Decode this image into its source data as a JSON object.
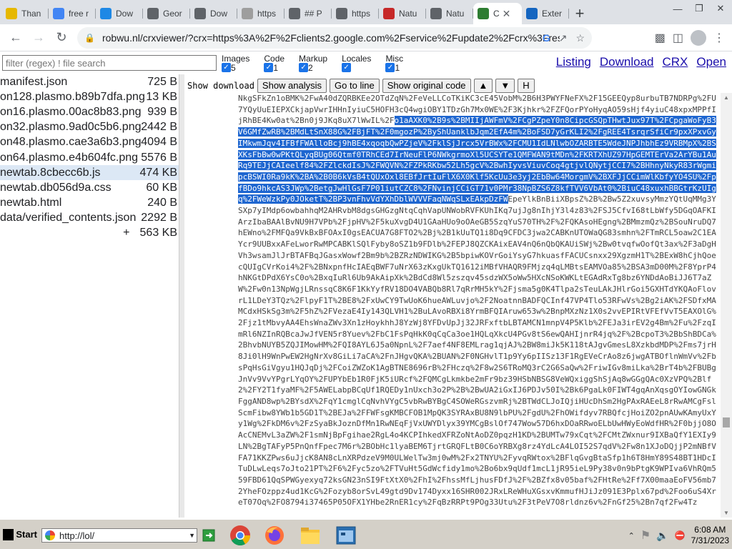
{
  "browser": {
    "tabs": [
      {
        "title": "Than",
        "icon": "tumblr-icon",
        "color": "#e6b800"
      },
      {
        "title": "free r",
        "icon": "google-icon",
        "color": "#4285f4"
      },
      {
        "title": "Dow",
        "icon": "vscode-icon",
        "color": "#1e88e5"
      },
      {
        "title": "Geor",
        "icon": "page-icon",
        "color": "#5f6368"
      },
      {
        "title": "Dow",
        "icon": "globe-icon",
        "color": "#5f6368"
      },
      {
        "title": "https",
        "icon": "image-icon",
        "color": "#9e9e9e"
      },
      {
        "title": "## P",
        "icon": "page-icon",
        "color": "#5f6368"
      },
      {
        "title": "https",
        "icon": "globe-icon",
        "color": "#5f6368"
      },
      {
        "title": "Natu",
        "icon": "page-icon",
        "color": "#c62828"
      },
      {
        "title": "Natu",
        "icon": "globe-icon",
        "color": "#5f6368"
      },
      {
        "title": "C",
        "icon": "crx-icon",
        "color": "#2e7d32",
        "active": true
      },
      {
        "title": "Exter",
        "icon": "puzzle-icon",
        "color": "#1565c0"
      }
    ],
    "url": "robwu.nl/crxviewer/?crx=https%3A%2F%2Fclients2.google.com%2Fservice%2Fupdate2%2Fcrx%3Fres..."
  },
  "viewer": {
    "filter_placeholder": "filter (regex) ! file search",
    "categories": [
      {
        "label": "Images",
        "count": "5"
      },
      {
        "label": "Code",
        "count": "1"
      },
      {
        "label": "Markup",
        "count": "2"
      },
      {
        "label": "Locales",
        "count": ""
      },
      {
        "label": "Misc",
        "count": "1"
      }
    ],
    "links": [
      "Listing",
      "Download",
      "CRX",
      "Open"
    ],
    "files": [
      {
        "name": "manifest.json",
        "size": "725 B"
      },
      {
        "name": "on128.plasmo.b89b7dfa.png",
        "size": "13 KB"
      },
      {
        "name": "on16.plasmo.00ac8b83.png",
        "size": "939 B"
      },
      {
        "name": "on32.plasmo.9ad0c5b6.png",
        "size": "2442 B"
      },
      {
        "name": "on48.plasmo.cae3a6b3.png",
        "size": "4094 B"
      },
      {
        "name": "on64.plasmo.e4b604fc.png",
        "size": "5576 B"
      },
      {
        "name": "newtab.8cbecc6b.js",
        "size": "474 KB",
        "selected": true
      },
      {
        "name": "newtab.db056d9a.css",
        "size": "60 KB"
      },
      {
        "name": "newtab.html",
        "size": "240 B"
      },
      {
        "name": "data/verified_contents.json",
        "size": "2292 B"
      },
      {
        "name": "+",
        "size": "563 KB",
        "total": true
      }
    ],
    "codebar": {
      "show_download": "Show download",
      "show_analysis": "Show analysis",
      "go_to_line": "Go to line",
      "show_original": "Show original code",
      "up": "▲",
      "down": "▼",
      "h": "H"
    },
    "code_before": "NkgSFkZn1oBMK%2FwA40dZQRBKEe2OTdZqN%2FeVeLLCoTKiKC3cE45VobM%2B6H3PWYFNeFX%2F15GEEQyp8urbuTB7NDRPg%2FU7YQyUuEIEPXCkjapVwrIHHnIyiuC5HOFH3cQ4wgiOBY1TDzGh7Mx0WE%2F3Kjhkr%2FZFQorPYoHyqAO59sHjf4yiuC48xpxMPPfIjRhBE4Kw0at%2Bn0j9JKq8uX7lWwIL%2F",
    "code_selected": "o1aAXK0%2B9s%2BMIIjAWFmV%2FCgPZpeY0n8CipcGSQpTHwtJux97T%2FCpgaWoFyB3V6GMfZwRB%2BMdLtSnX88G%2FBjFT%2F0mgozP%2ByShUanklbJqm2EfA4m%2BoFSD7yGrKLI2%2FgREE4TsrqrSfiCr9pxXPxvGyIMkwmJqv4IFBfFWAlloBcj9hBE4xqoqbQwPZjeV%2FklSjJrcx5VrBWx%2FCMU1IdLNlwbOZARBTE5WdeJNPJhbhEz9VRBMpX%2BSXKsFbBw0wPKtQLyqBUg06Qtmf0TRhCEd7IrNeuFlP6NWkgrmoXl5UCSYTe1QMFWAN9tMDn%2FKRTXhUZ97HpGEMTErVa2ArYBu1AuRq9TEJjCAIeelf84%2FZlckdIsJ%2FWQVN%2FZPkRKbw52Lh5gcV%2BwhIyvsViuvCoq4gtjvlQNytjCCI7%2BHhnyNkyR83rWgmipcBSWI0Ra9kK%2BA%2B0B6kVsB4tQUxOxl8EBfJrtIuFlX6X0Klf5KcUu3e3yj2EbBw64MorgmV%2BXFJjCCimWlKbfyYO4SU%2FpfBDo9hkcAS3JWp%2BetgJwHlGsF7P01iutCZC8%2FNvinjCCiGT71v0PMr38NpBZS6Z8kfTVV6VbAt0%2BiuC48xuxhBBGtrKzUIgq%2FWeWzkPy0JOketT%2BP3vnFhvVdYXhDblWVVVFaqNWqSLxEAkpDzFW",
    "code_after": "EpeYlkBnBiiXBpsZ%2B%2Bw5Z2xuvsyMmzYQtUqMMg3YSXp7yIMdp6owbahhqM2AHRvbM8dgsGHGzgNtqCqhVapUNWobRVFKUhIKq7ujJg8nIhjY3l4z83%2FSJ5CfvI68tLbWfy5DGqOAFKIArzIbaBAAlBvNU9H7VPb%2FjpHV%2F5kuXvgD4U1GAaHUo9oOAeGB5SzqYuS70TH%2F%2FQKAsoHEgng%2BMmzmQz%2BSouNruDQ7hEWno%2FMFQa9VkBxBFOAxI0gsEACUA7G8FTO2%2Bj%2B1kUuTQ1i8Dq9CFDC3jwa2CABKnUTOWaQG83smhn%2FTmRCL5oaw2C1EAYcr9UUBxxAFeLworRwMPCABKlSQlFyby8oSZ1b9FDlb%2FEPJ8QZCKAixEAV4nQ6nQbQKAUiSWj%2Bw0tvqfwOofQt3ax%2F3aDgHVh3wsamJlJrBTAFBqJGasxWowf2Bm9b%2BZRzNDWIKG%2B5bpiwKOVrGoiYsyG7hkuasfFACUCsnxx29XgzmH1T%2BExW8hCjhQoecQUIgCVrKoi4%2F%2BNxpnfHcIAEqBWF7uNrX63zKxgUkTQ1612iMBfVHAQR9FMjzq4qLMBtsEAMVOa85%2BSA3mD00M%2F8YprP4hNKGtDPdX6YsC0o%2BxqIuRl6Ub9AkAipXk%2BdCd8Wl5zszqv45sdzWX5oWw5HXcNSoKWKLtEGAdRxTg8bz6YNDdAoBiJJ6T7aZW%2Fw0n13NpWgjLRnssqC8K6F1KkYyfRV18DO4VABQb8Rl7qRrMH5kY%2Fjsma5g0K4Tlpa2sTeuLAkJHlrGoi5GXHTdYKQAoFlovrL1LDeY3TQz%2FlpyF1T%2BE8%2FxUwCY9TwUoK6hueAWLuvjo%2F2NoatnnBADFQCInf47VP4Tlo53RFwVs%2Bg2iAK%2FSDfxMAMCdxHSkSg3m%2F5hZ%2FVezaE4Iy143QLVH1%2BuLAvoRBXi8YrmBFQIAruw653w%2BnpMXzNz1X0s2vvEPIRtVFEfVvT5EAXOlG%2Fjz1tMbvyAA4EhsWnaZWv3Xn1zHoykhhJ8YzWj8YFDvUpJj32JRFxftbLBTAMCN1mnpV4P5Klb%2FEJa3irEV2g4Bm%2Fu%2FzqImRl6NZInRQBcaJwJfVEN5r8Yuev%2FbC1FsPqHkK0qCqCa3oe1HQLqXkcU4PGv8tS6ewQAHIjnrR4jq%2F%2BcpoT3%2BbShBDCa%2BhvbNUYB5ZQJIMowHM%2FQI8AYL6J5a0NpnL%2F7aef4NF8EMLrag1qjAJ%2BW8miJk5K118tAJgvGmesL8XzkbdMDP%2Fms7jrH8Ji0lH9WnPwEW2HgNrXv8GiLi7aCA%2FnJHgvQKA%2BUAN%2F0NGHvlT1p9Yy6pIISz13F1RgEVeCrAo8z6jwgATBOflnWmVv%2FbsPqHsGiVgyu1HQJqDj%2FCoiZWZoK1AgBTNE8696rB%2FHczq%2F8w2S6TRoMQ3rC2G6SaQw%2FriwIGv8miLka%2BrT4b%2FBUBgJnVv9VvYPgrLYqOY%2FUPYbEb1R0FjK5iURcf%2FQMCgLkmkbe2mFr9bz39HSbNBSG8VeWQxiggShSjAq8wGGgQAc0XzVPQ%2Blf2%2FY2T1fyaMF%2F5AWELabpBCqUf1RQEDy1nUxch3o2P%2B%2BwUA2iGxIJ6PDJv50I%2Bk6PgaLk0FIWT4gqAnXqsgOYIowGNGkFggAND8wp%2BYsdX%2FqY1cmglCqNvhVYgC5vbRwBYBgC4SOWeRGszvmRj%2BTWdCLJoIQjiHUcDhSm2HgPAxRAEeL8rRwAMCgFslScmFibw8YWb1b5GD1T%2BEJa%2FFWFsgKMBCFOB1MpQK3SYRAxBU8N9lbPU%2FgdU%2FhOWifdyv7RBQfcjHoiZO2pnAUwKAmyUxYy1Wg%2FkDM6v%2FzSyaBkJoznDfMn1RwNEqFjVxUWYDlyx39YMCgBslOf747Wow57D6hxDOaRRwoELbUwHWyEoWdfHR%2F0bjjO8OAcCNEMvL3aZW%2F1smNjBpFgihae2RgL4o4KCPIhkedXFRZoNtAoDZ0pqzH1KD%2BUMTw79xCqt%2FCMtZWxnur9IXBaQfY1EXIy9LN%2BgTAFyP5PnQnfFpec7M6r%2BObHc1lyaBEM6TjrtGRQFLtB0C6oYRBXg8rz4YdLcA4LOI52S7qdV%2Fw8n1XJoDQjjP2mNBfVFA71KKZPws6uJjcK8AN8cLnXRPdzeV9M0ULWelTw3mj0wM%2Fx2TNYU%2FyvqRWtox%2BFlqGvgBtaSfp1h6T8HmY89S48BT1HDcITuDLwLeqs7oJto21PT%2F6%2Fyc5zo%2FTVuHt5GdWcfidy1mo%2Bo6bx9qUdf1mcL1jR95ieL9Py38v0n9bPtgK9WPIva6VhRQm559FBD61QqSPWGyexyq72ksGN23nSI9FtXtX0%2FhI%2FhssMfLjhusFDfJ%2F%2BZfx8v05baf%2FHtRe%2Ff7X00maaEoFV56mb72YheFOzppz4ud1KcG%2Fozyb8orSvL49gtd9Dv174Dyxx16SHR002JRxLReWHuXGsxvKmmufHJiJz091E3Pplx67pd%2Foo6uS4XreT07Oq%2FO8794i37465P05OFX1YHbe2RnER1cy%2FqBzRRPt9POg33Utu%2F3tPeV7O8rldnz6v%2FnGf25%2Bn7qf2Fw4Tz"
  },
  "taskbar": {
    "start": "Start",
    "address": "http://lol/",
    "time": "6:08 AM",
    "date": "7/31/2023"
  },
  "colors": {
    "selection": "#1e66d0",
    "link": "#1a0dab",
    "checkbox": "#1a73e8"
  }
}
